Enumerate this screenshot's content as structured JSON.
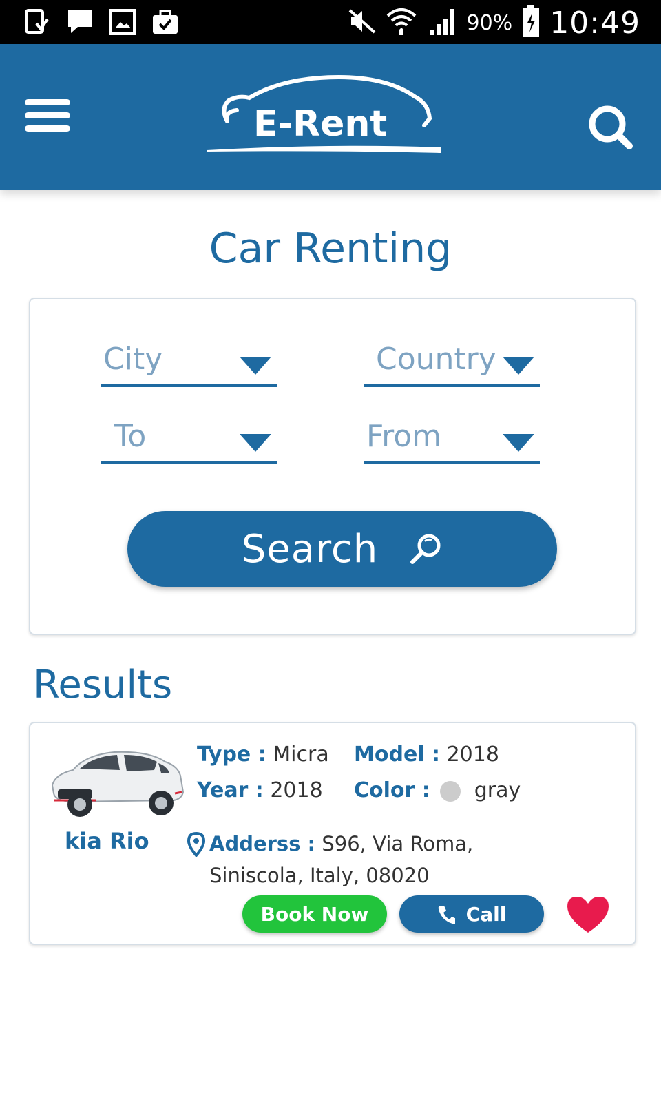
{
  "status_bar": {
    "battery": "90%",
    "time": "10:49",
    "left_icons": [
      "download-icon",
      "message-icon",
      "image-icon",
      "briefcase-icon"
    ],
    "right_icons": [
      "mute-icon",
      "wifi-icon",
      "signal-icon",
      "battery-icon"
    ]
  },
  "app_bar": {
    "logo_text": "E-Rent",
    "color": "#1e6aa1"
  },
  "page": {
    "title": "Car Renting"
  },
  "search_form": {
    "city": "City",
    "country": "Country",
    "to": "To",
    "from": "From",
    "search_label": "Search"
  },
  "results": {
    "title": "Results",
    "items": [
      {
        "name": "kia Rio",
        "type_label": "Type :",
        "type_value": "Micra",
        "model_label": "Model :",
        "model_value": "2018",
        "year_label": "Year :",
        "year_value": "2018",
        "color_label": "Color :",
        "color_value": "gray",
        "address_label": "Adderss :",
        "address_line1": "S96, Via Roma,",
        "address_line2": "Siniscola, Italy, 08020",
        "book_label": "Book Now",
        "call_label": "Call"
      }
    ]
  },
  "colors": {
    "primary": "#1e6aa1",
    "book": "#22c43c",
    "heart": "#e81b4d",
    "color_swatch": "#cccccc"
  }
}
